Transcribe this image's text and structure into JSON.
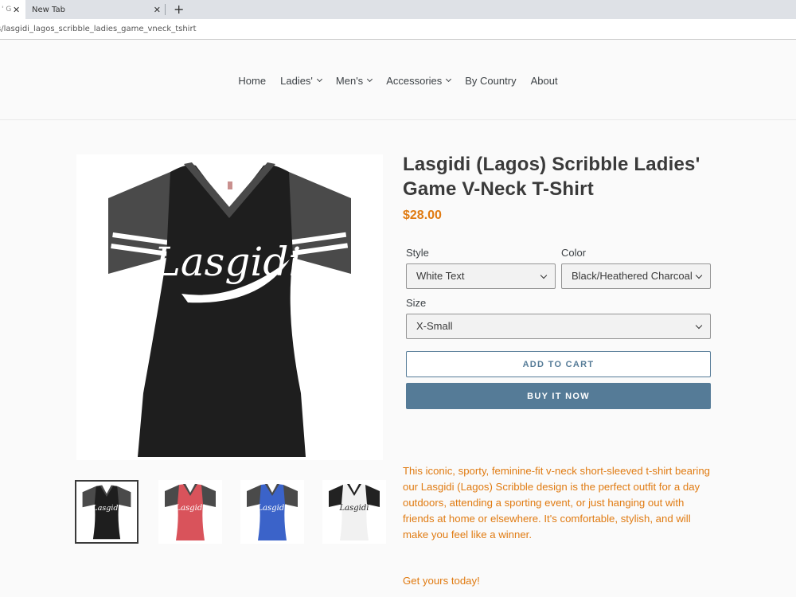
{
  "browser": {
    "tabs": [
      {
        "title": "' G",
        "active": true
      },
      {
        "title": "New Tab",
        "active": false
      }
    ],
    "close_glyph": "✕",
    "new_tab_glyph": "+",
    "url": "s/lasgidi_lagos_scribble_ladies_game_vneck_tshirt"
  },
  "nav": {
    "items": [
      {
        "label": "Home",
        "has_dropdown": false
      },
      {
        "label": "Ladies'",
        "has_dropdown": true
      },
      {
        "label": "Men's",
        "has_dropdown": true
      },
      {
        "label": "Accessories",
        "has_dropdown": true
      },
      {
        "label": "By Country",
        "has_dropdown": false
      },
      {
        "label": "About",
        "has_dropdown": false
      }
    ]
  },
  "product": {
    "title": "Lasgidi (Lagos) Scribble Ladies' Game V-Neck T-Shirt",
    "price": "$28.00",
    "image_text": "Lasgidi",
    "options": {
      "style": {
        "label": "Style",
        "value": "White Text"
      },
      "color": {
        "label": "Color",
        "value": "Black/Heathered Charcoal"
      },
      "size": {
        "label": "Size",
        "value": "X-Small"
      }
    },
    "add_to_cart_label": "ADD TO CART",
    "buy_now_label": "BUY IT NOW",
    "description": "This iconic, sporty, feminine-fit v-neck short-sleeved t-shirt bearing our Lasgidi (Lagos) Scribble design is the perfect outfit for a day outdoors, attending a sporting event, or just hanging out with friends at home or elsewhere. It's comfortable, stylish, and will make you feel like a winner.",
    "cta": "Get yours today!",
    "thumbnails": [
      {
        "body": "#1e1e1e",
        "sleeve": "#4a4a4a",
        "text": "#ffffff",
        "selected": true
      },
      {
        "body": "#d9535b",
        "sleeve": "#4a4a4a",
        "text": "#ffffff",
        "selected": false
      },
      {
        "body": "#3b63c9",
        "sleeve": "#4a4a4a",
        "text": "#ffffff",
        "selected": false
      },
      {
        "body": "#f1f1f1",
        "sleeve": "#222222",
        "text": "#222222",
        "selected": false
      }
    ]
  },
  "colors": {
    "accent_orange": "#e07b12",
    "button_blue": "#557b97"
  }
}
